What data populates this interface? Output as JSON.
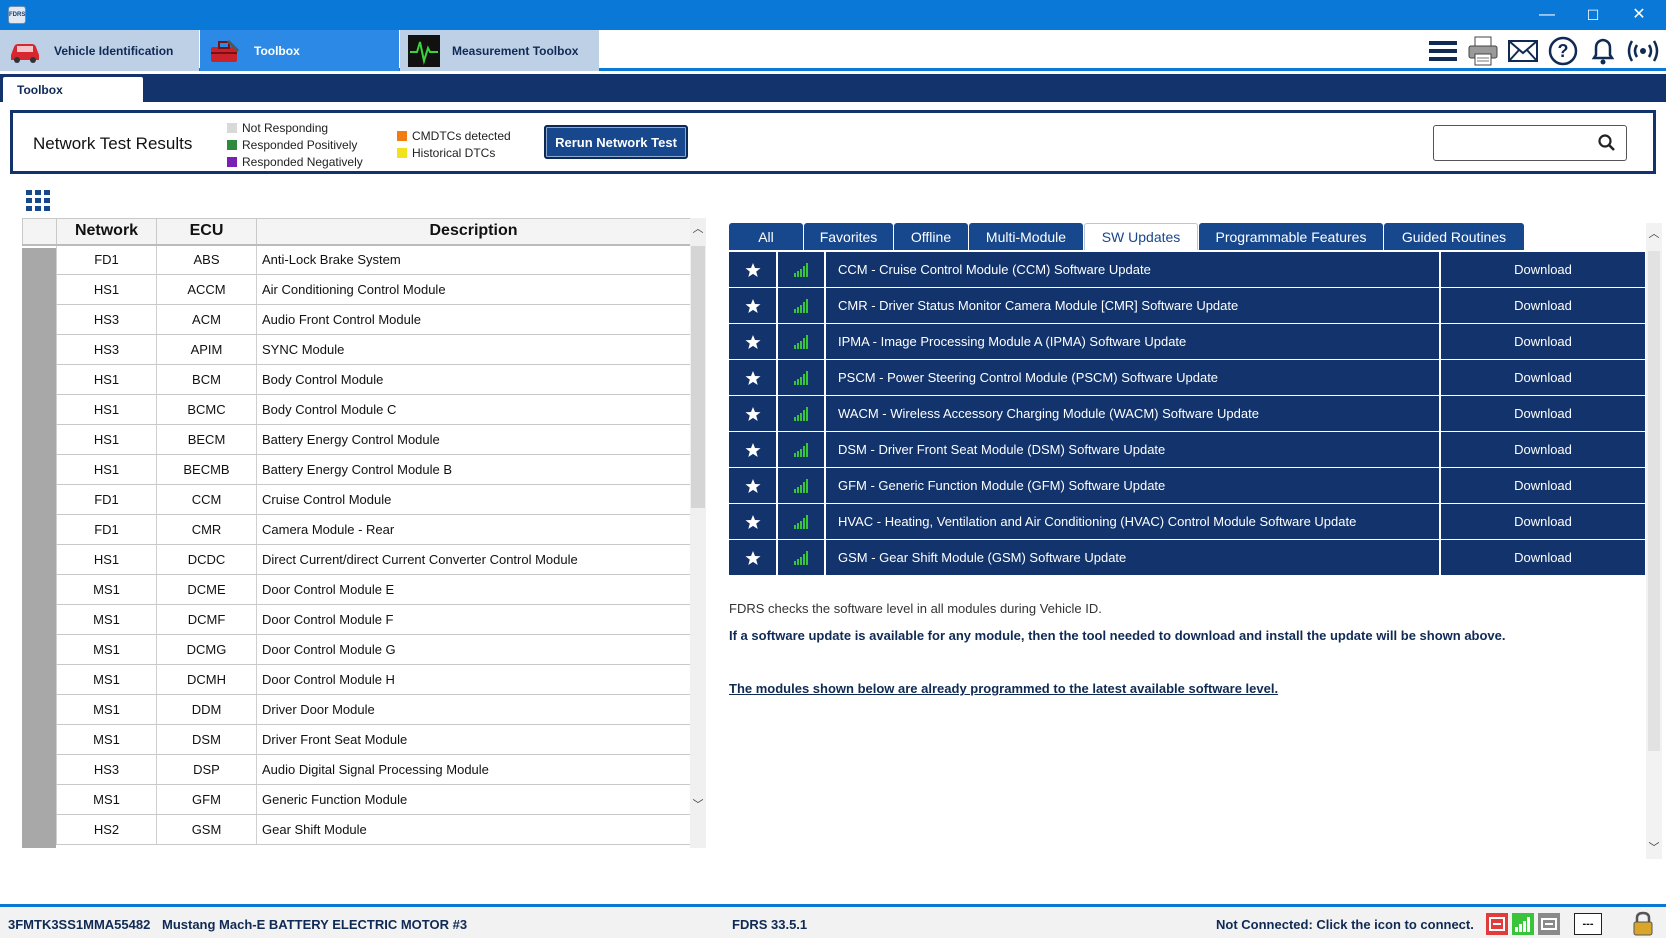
{
  "window": {
    "app_icon": "FDRS",
    "minimize": "—",
    "maximize": "☐",
    "close": "✕"
  },
  "tabs": [
    {
      "label": "Vehicle Identification",
      "icon": "car-icon"
    },
    {
      "label": "Toolbox",
      "icon": "toolbox-icon"
    },
    {
      "label": "Measurement Toolbox",
      "icon": "oscilloscope-icon"
    }
  ],
  "toolbar_icons": [
    "menu-icon",
    "printer-icon",
    "mail-icon",
    "help-icon",
    "bell-icon",
    "wireless-icon"
  ],
  "subtab": {
    "label": "Toolbox"
  },
  "network": {
    "title": "Network Test Results",
    "legend": [
      {
        "label": "Not Responding",
        "color": "#d9d9d9"
      },
      {
        "label": "Responded Positively",
        "color": "#2e8b3d"
      },
      {
        "label": "Responded Negatively",
        "color": "#7a1fb3"
      },
      {
        "label": "CMDTCs detected",
        "color": "#f07c12"
      },
      {
        "label": "Historical DTCs",
        "color": "#f2e21c"
      }
    ],
    "rerun_label": "Rerun Network Test",
    "search_placeholder": ""
  },
  "ecu_table": {
    "headers": {
      "network": "Network",
      "ecu": "ECU",
      "description": "Description"
    },
    "rows": [
      {
        "network": "FD1",
        "ecu": "ABS",
        "description": "Anti-Lock Brake System"
      },
      {
        "network": "HS1",
        "ecu": "ACCM",
        "description": "Air Conditioning Control Module"
      },
      {
        "network": "HS3",
        "ecu": "ACM",
        "description": "Audio Front Control Module"
      },
      {
        "network": "HS3",
        "ecu": "APIM",
        "description": "SYNC Module"
      },
      {
        "network": "HS1",
        "ecu": "BCM",
        "description": "Body Control Module"
      },
      {
        "network": "HS1",
        "ecu": "BCMC",
        "description": "Body Control Module C"
      },
      {
        "network": "HS1",
        "ecu": "BECM",
        "description": "Battery Energy Control Module"
      },
      {
        "network": "HS1",
        "ecu": "BECMB",
        "description": "Battery Energy Control Module B"
      },
      {
        "network": "FD1",
        "ecu": "CCM",
        "description": "Cruise Control Module"
      },
      {
        "network": "FD1",
        "ecu": "CMR",
        "description": "Camera Module - Rear"
      },
      {
        "network": "HS1",
        "ecu": "DCDC",
        "description": "Direct Current/direct Current Converter Control Module"
      },
      {
        "network": "MS1",
        "ecu": "DCME",
        "description": "Door Control Module E"
      },
      {
        "network": "MS1",
        "ecu": "DCMF",
        "description": "Door Control Module F"
      },
      {
        "network": "MS1",
        "ecu": "DCMG",
        "description": "Door Control Module G"
      },
      {
        "network": "MS1",
        "ecu": "DCMH",
        "description": "Door Control Module H"
      },
      {
        "network": "MS1",
        "ecu": "DDM",
        "description": "Driver Door Module"
      },
      {
        "network": "MS1",
        "ecu": "DSM",
        "description": "Driver Front Seat Module"
      },
      {
        "network": "HS3",
        "ecu": "DSP",
        "description": "Audio Digital Signal Processing Module"
      },
      {
        "network": "MS1",
        "ecu": "GFM",
        "description": "Generic Function Module"
      },
      {
        "network": "HS2",
        "ecu": "GSM",
        "description": "Gear Shift Module"
      }
    ]
  },
  "right_tabs": [
    {
      "label": "All",
      "active": false
    },
    {
      "label": "Favorites",
      "active": false
    },
    {
      "label": "Offline",
      "active": false
    },
    {
      "label": "Multi-Module",
      "active": false
    },
    {
      "label": "SW Updates",
      "active": true
    },
    {
      "label": "Programmable Features",
      "active": false
    },
    {
      "label": "Guided Routines",
      "active": false
    }
  ],
  "sw_updates": [
    {
      "name": "CCM - Cruise Control Module (CCM) Software Update",
      "action": "Download"
    },
    {
      "name": "CMR - Driver Status Monitor Camera Module [CMR] Software Update",
      "action": "Download"
    },
    {
      "name": "IPMA - Image Processing Module A (IPMA) Software Update",
      "action": "Download"
    },
    {
      "name": "PSCM - Power Steering Control Module (PSCM) Software Update",
      "action": "Download"
    },
    {
      "name": "WACM - Wireless Accessory Charging Module (WACM) Software Update",
      "action": "Download"
    },
    {
      "name": "DSM - Driver Front Seat Module (DSM) Software Update",
      "action": "Download"
    },
    {
      "name": "GFM - Generic Function Module (GFM) Software Update",
      "action": "Download"
    },
    {
      "name": "HVAC - Heating, Ventilation and Air Conditioning (HVAC) Control Module Software Update",
      "action": "Download"
    },
    {
      "name": "GSM - Gear Shift Module (GSM) Software Update",
      "action": "Download"
    }
  ],
  "info": {
    "line1": "FDRS checks the software level in all modules during Vehicle ID.",
    "line2": "If a software update is available for any module, then the tool needed to download and install the update will be shown above.",
    "line3": "The modules shown below are already programmed to the latest available software level."
  },
  "status": {
    "vin": "3FMTK3SS1MMA55482",
    "vehicle": "Mustang Mach-E BATTERY ELECTRIC MOTOR #3",
    "version": "FDRS 33.5.1",
    "connection": "Not Connected: Click the icon to connect.",
    "dash_label": "---"
  },
  "colors": {
    "accent": "#0a78d7",
    "navy": "#12336b",
    "button": "#17478c",
    "signal": "#39c43a",
    "status_red": "#e23b3b"
  }
}
